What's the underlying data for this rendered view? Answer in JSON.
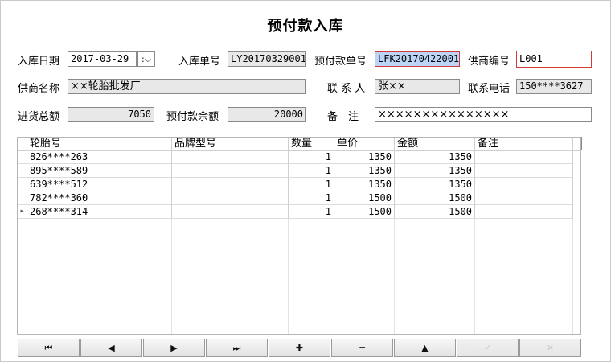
{
  "title": "预付款入库",
  "form": {
    "date_label": "入库日期",
    "date_value": "2017-03-29",
    "dropdown_glyph": ":⌵",
    "entry_no_label": "入库单号",
    "entry_no_value": "LY20170329001",
    "prepay_no_label": "预付款单号",
    "prepay_no_value": "LFK20170422001",
    "supplier_code_label": "供商编号",
    "supplier_code_value": "L001",
    "supplier_name_label": "供商名称",
    "supplier_name_value": "××轮胎批发厂",
    "contact_label": "联 系 人",
    "contact_value": "张××",
    "phone_label": "联系电话",
    "phone_value": "150****3627",
    "total_label": "进货总额",
    "total_value": "7050",
    "balance_label": "预付款余额",
    "balance_value": "20000",
    "note_label": "备　注",
    "note_value": "×××××××××××××××"
  },
  "grid": {
    "columns": [
      "轮胎号",
      "品牌型号",
      "数量",
      "单价",
      "金额",
      "备注"
    ],
    "rows": [
      {
        "tire": "826****263",
        "brand": "",
        "qty": "1",
        "price": "1350",
        "amount": "1350",
        "note": ""
      },
      {
        "tire": "895****589",
        "brand": "",
        "qty": "1",
        "price": "1350",
        "amount": "1350",
        "note": ""
      },
      {
        "tire": "639****512",
        "brand": "",
        "qty": "1",
        "price": "1350",
        "amount": "1350",
        "note": ""
      },
      {
        "tire": "782****360",
        "brand": "",
        "qty": "1",
        "price": "1500",
        "amount": "1500",
        "note": ""
      },
      {
        "tire": "268****314",
        "brand": "",
        "qty": "1",
        "price": "1500",
        "amount": "1500",
        "note": ""
      }
    ],
    "current_row_marker": "▸"
  },
  "toolbar": {
    "first": "⏮",
    "prev": "◀",
    "next": "▶",
    "last": "⏭",
    "add": "✚",
    "delete": "━",
    "up": "▲",
    "confirm": "✓",
    "cancel": "✕"
  }
}
